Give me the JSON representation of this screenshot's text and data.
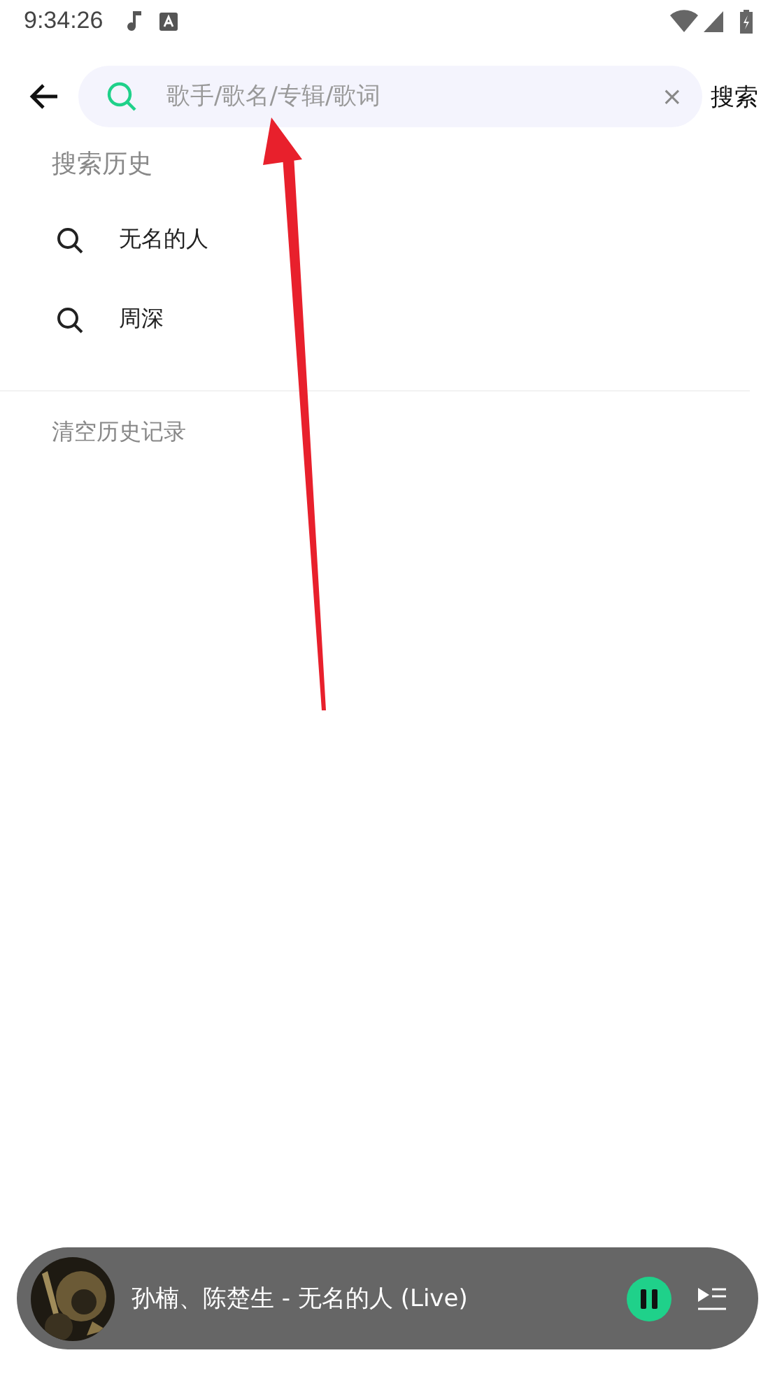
{
  "status_bar": {
    "time": "9:34:26"
  },
  "search": {
    "placeholder": "歌手/歌名/专辑/歌词",
    "clear": "×",
    "submit": "搜索"
  },
  "history": {
    "title": "搜索历史",
    "items": [
      {
        "text": "无名的人"
      },
      {
        "text": "周深"
      }
    ],
    "clear_label": "清空历史记录"
  },
  "player": {
    "track": "孙楠、陈楚生 - 无名的人 (Live)",
    "playing": true
  },
  "annotation": {
    "kind": "arrow"
  }
}
